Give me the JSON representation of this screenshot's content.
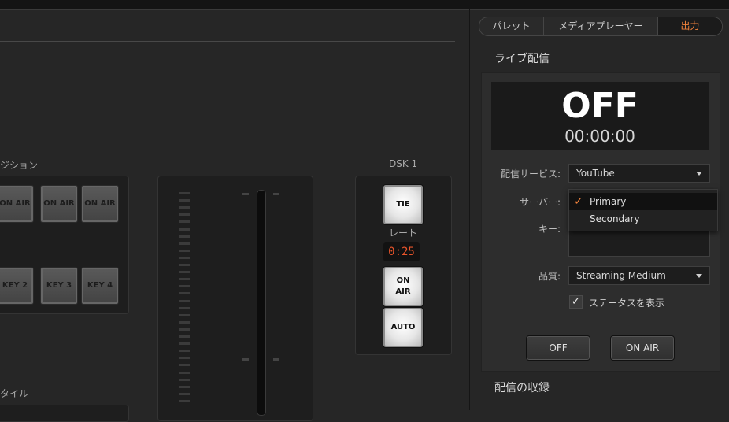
{
  "left": {
    "transition_title": "ジション",
    "style_title": "タイル",
    "key_on_air_buttons": [
      {
        "label": "ON AIR"
      },
      {
        "label": "ON AIR"
      },
      {
        "label": "ON AIR"
      }
    ],
    "key_buttons": [
      {
        "label": "KEY 2"
      },
      {
        "label": "KEY 3"
      },
      {
        "label": "KEY 4"
      }
    ]
  },
  "dsk": {
    "title": "DSK 1",
    "tie_label": "TIE",
    "rate_label": "レート",
    "rate_value": "0:25",
    "on_air_label": "ON AIR",
    "auto_label": "AUTO"
  },
  "tabs": [
    {
      "label": "パレット",
      "active": false
    },
    {
      "label": "メディアプレーヤー",
      "active": false
    },
    {
      "label": "出力",
      "active": true
    }
  ],
  "live": {
    "title": "ライブ配信",
    "status": "OFF",
    "timecode": "00:00:00",
    "service_label": "配信サービス:",
    "service_value": "YouTube",
    "server_label": "サーバー:",
    "server_options": [
      {
        "label": "Primary",
        "selected": true
      },
      {
        "label": "Secondary",
        "selected": false
      }
    ],
    "key_label": "キー:",
    "key_value": "",
    "quality_label": "品質:",
    "quality_value": "Streaming Medium",
    "show_status_label": "ステータスを表示",
    "show_status_checked": true,
    "off_button": "OFF",
    "on_air_button": "ON AIR"
  },
  "recording": {
    "title": "配信の収録"
  },
  "colors": {
    "accent": "#f0823c",
    "rate_text": "#e8542a"
  }
}
